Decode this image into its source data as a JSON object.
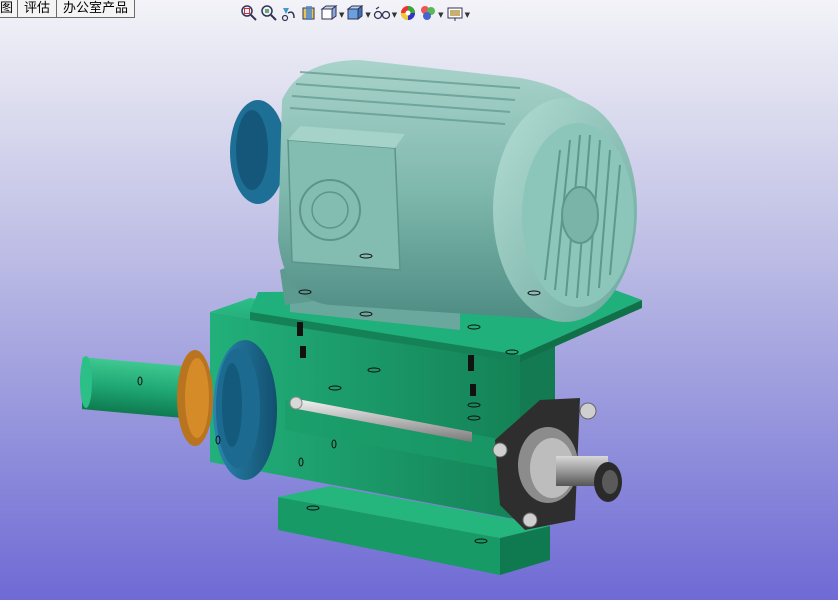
{
  "tabs": [
    "图",
    "评估",
    "办公室产品"
  ],
  "toolbar": {
    "items": [
      {
        "icon": "zoom-to-fit-icon",
        "dropdown": false
      },
      {
        "icon": "zoom-to-area-icon",
        "dropdown": false
      },
      {
        "icon": "previous-view-icon",
        "dropdown": false
      },
      {
        "icon": "section-view-icon",
        "dropdown": false
      },
      {
        "icon": "view-orientation-icon",
        "dropdown": true
      },
      {
        "icon": "display-style-icon",
        "dropdown": true
      },
      {
        "icon": "hide-show-items-icon",
        "dropdown": true
      },
      {
        "icon": "edit-appearance-icon",
        "dropdown": false
      },
      {
        "icon": "apply-scene-icon",
        "dropdown": true
      },
      {
        "icon": "view-settings-icon",
        "dropdown": true
      }
    ]
  },
  "model": {
    "name": "spindle-motor-assembly",
    "colors": {
      "motor": "#7fb8ad",
      "base": "#1ea575",
      "pulley": "#1e6f95",
      "background_top": "#f3f3f8",
      "background_bottom": "#6f6ad5"
    }
  }
}
